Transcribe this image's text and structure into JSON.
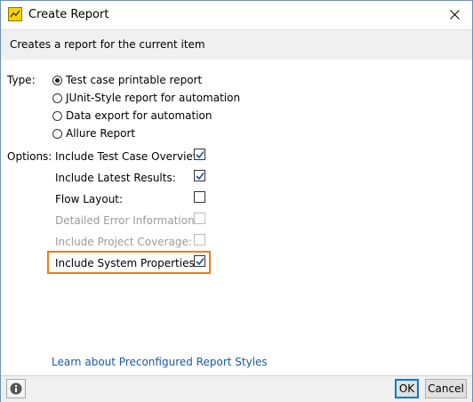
{
  "window": {
    "title": "Create Report"
  },
  "subheader": {
    "text": "Creates a report for the current item"
  },
  "type_section": {
    "label": "Type:",
    "options": [
      {
        "label": "Test case printable report",
        "selected": true
      },
      {
        "label": "JUnit-Style report for automation",
        "selected": false
      },
      {
        "label": "Data export for automation",
        "selected": false
      },
      {
        "label": "Allure Report",
        "selected": false
      }
    ]
  },
  "options_section": {
    "label": "Options:",
    "items": [
      {
        "label": "Include Test Case Overview:",
        "checked": true,
        "enabled": true
      },
      {
        "label": "Include Latest Results:",
        "checked": true,
        "enabled": true
      },
      {
        "label": "Flow Layout:",
        "checked": false,
        "enabled": true
      },
      {
        "label": "Detailed Error Information:",
        "checked": false,
        "enabled": false
      },
      {
        "label": "Include Project Coverage:",
        "checked": false,
        "enabled": false
      },
      {
        "label": "Include System Properties:",
        "checked": true,
        "enabled": true
      }
    ]
  },
  "link": {
    "text": "Learn about Preconfigured Report Styles"
  },
  "footer": {
    "ok_label": "OK",
    "cancel_label": "Cancel"
  },
  "icons": {
    "app": "report-app-icon",
    "close": "close-icon",
    "info": "info-icon",
    "check": "checkmark-icon"
  },
  "colors": {
    "highlight": "#f07d10",
    "link": "#1a5aa8",
    "ok_border": "#0078d7"
  }
}
